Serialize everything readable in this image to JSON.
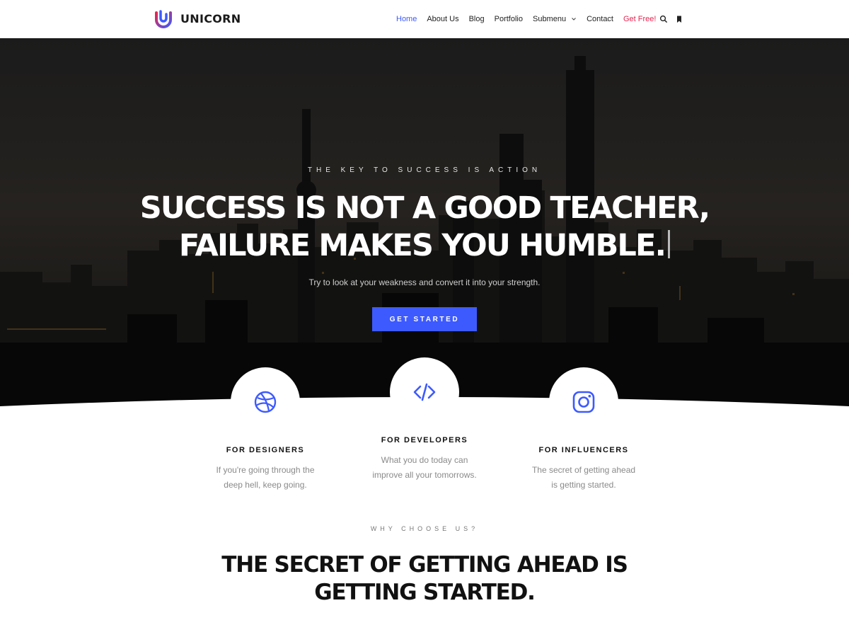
{
  "brand": {
    "name": "UNICORN",
    "logo_icon": "unicorn-logo-icon"
  },
  "nav": {
    "items": [
      {
        "label": "Home",
        "state": "active"
      },
      {
        "label": "About Us"
      },
      {
        "label": "Blog"
      },
      {
        "label": "Portfolio"
      },
      {
        "label": "Submenu",
        "has_dropdown": true
      },
      {
        "label": "Contact"
      },
      {
        "label": "Get Free!",
        "state": "highlight"
      }
    ],
    "icons": [
      "search-icon",
      "bookmark-icon"
    ]
  },
  "hero": {
    "eyebrow": "THE KEY TO SUCCESS IS ACTION",
    "title_line1": "SUCCESS IS NOT A GOOD TEACHER,",
    "title_line2": "FAILURE MAKES YOU HUMBLE.",
    "subtitle": "Try to look at your weakness and convert it into your strength.",
    "button": "GET STARTED",
    "background": "night city skyline"
  },
  "features": [
    {
      "icon": "dribbble-icon",
      "title": "FOR DESIGNERS",
      "text_line1": "If you're going through the",
      "text_line2": "deep hell, keep going."
    },
    {
      "icon": "code-icon",
      "title": "FOR DEVELOPERS",
      "text_line1": "What you do today can",
      "text_line2": "improve all your tomorrows."
    },
    {
      "icon": "instagram-icon",
      "title": "FOR INFLUENCERS",
      "text_line1": "The secret of getting ahead",
      "text_line2": "is getting started."
    }
  ],
  "why": {
    "eyebrow": "WHY CHOOSE US?",
    "title_line1": "THE SECRET OF GETTING AHEAD IS",
    "title_line2": "GETTING STARTED."
  },
  "colors": {
    "accent": "#3d5afe",
    "cta": "#e8254f",
    "logo_pink": "#e8254f",
    "logo_blue": "#3d5afe"
  }
}
